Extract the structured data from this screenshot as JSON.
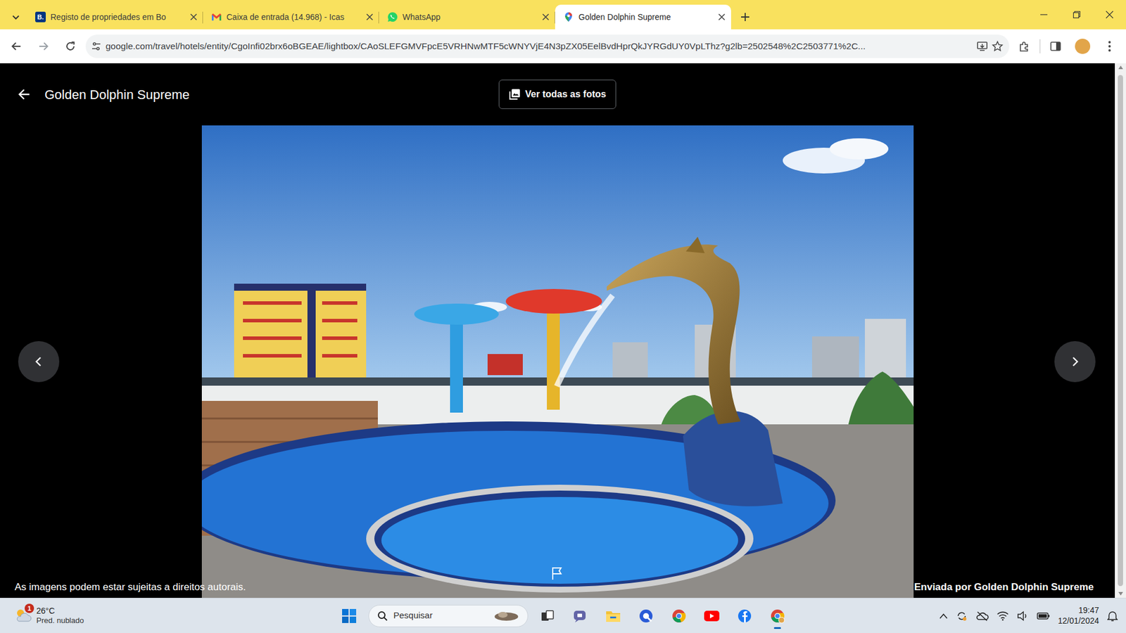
{
  "browser": {
    "tabs": [
      {
        "label": "Registo de propriedades em Bo",
        "selected": false,
        "favicon_text": "B."
      },
      {
        "label": "Caixa de entrada (14.968) - Icas",
        "selected": false
      },
      {
        "label": "WhatsApp",
        "selected": false
      },
      {
        "label": "Golden Dolphin Supreme",
        "selected": true
      }
    ],
    "address": "google.com/travel/hotels/entity/CgoInfi02brx6oBGEAE/lightbox/CAoSLEFGMVFpcE5VRHNwMTF5cWNYVjE4N3pZX05EelBvdHprQkJYRGdUY0VpLThz?g2lb=2502548%2C2503771%2C..."
  },
  "page": {
    "title": "Golden Dolphin Supreme",
    "all_photos_button": "Ver todas as fotos",
    "copyright": "As imagens podem estar sujeitas a direitos autorais.",
    "credit": "Enviada por Golden Dolphin Supreme"
  },
  "taskbar": {
    "weather": {
      "temp": "26°C",
      "desc": "Pred. nublado",
      "badge": "1"
    },
    "search": {
      "label": "Pesquisar"
    },
    "time": "19:47",
    "date": "12/01/2024"
  }
}
